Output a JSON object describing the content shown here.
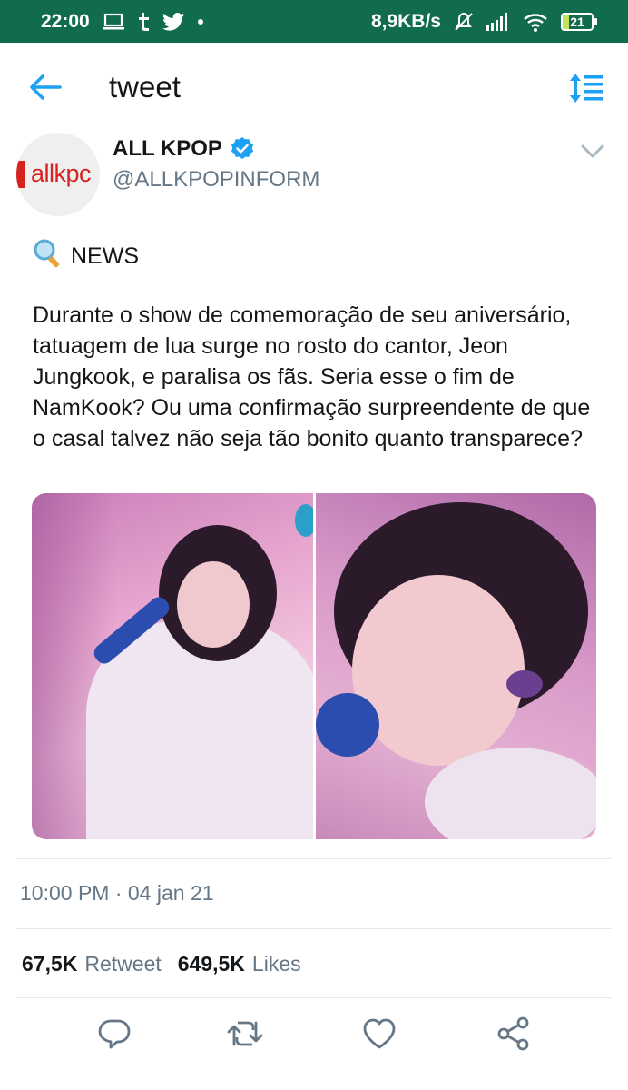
{
  "status_bar": {
    "time": "22:00",
    "network_speed": "8,9KB/s",
    "battery_level": "21",
    "icons": [
      "laptop-icon",
      "tumblr-icon",
      "twitter-icon",
      "dot-icon",
      "mute-icon",
      "signal-icon",
      "wifi-icon",
      "battery-icon"
    ]
  },
  "header": {
    "title": "tweet",
    "back_icon": "back-arrow-icon",
    "sort_icon": "sort-icon"
  },
  "author": {
    "name": "ALL KPOP",
    "handle": "@ALLKPOPINFORM",
    "avatar_text": "allkpc",
    "verified": true
  },
  "tweet": {
    "tag": "NEWS",
    "text": "Durante o show de comemoração de seu aniversário, tatuagem de lua surge no rosto do cantor, Jeon Jungkook, e paralisa os fãs. Seria esse o fim de NamKook? Ou uma confirmação surpreendente de que o casal talvez não seja tão bonito quanto transparece?",
    "timestamp": "10:00 PM · 04 jan 21"
  },
  "stats": {
    "retweets_count": "67,5K",
    "retweets_label": "Retweet",
    "likes_count": "649,5K",
    "likes_label": "Likes"
  },
  "actions": [
    "reply-icon",
    "retweet-icon",
    "like-icon",
    "share-icon"
  ],
  "colors": {
    "status_bar": "#116b4f",
    "accent": "#1da1f2",
    "secondary_text": "#657786",
    "logo_red": "#d62320"
  }
}
